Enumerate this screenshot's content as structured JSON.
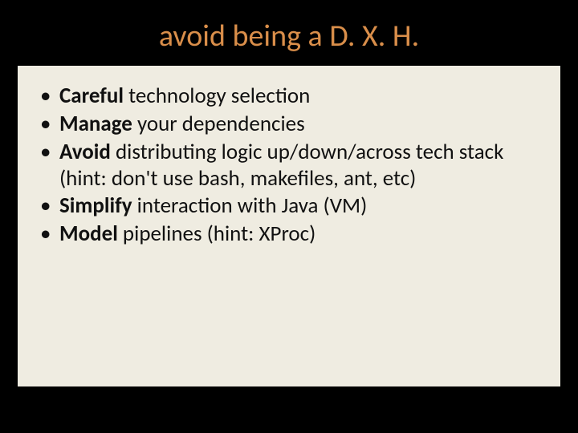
{
  "title": "avoid being a D. X. H.",
  "bullets": [
    {
      "bold": "Careful",
      "rest": " technology selection"
    },
    {
      "bold": "Manage",
      "rest": " your dependencies"
    },
    {
      "bold": "Avoid",
      "rest": " distributing logic up/down/across tech stack (hint: don't use bash, makefiles, ant, etc)"
    },
    {
      "bold": "Simplify",
      "rest": " interaction with Java (VM)"
    },
    {
      "bold": "Model",
      "rest": " pipelines (hint: XProc)"
    }
  ]
}
